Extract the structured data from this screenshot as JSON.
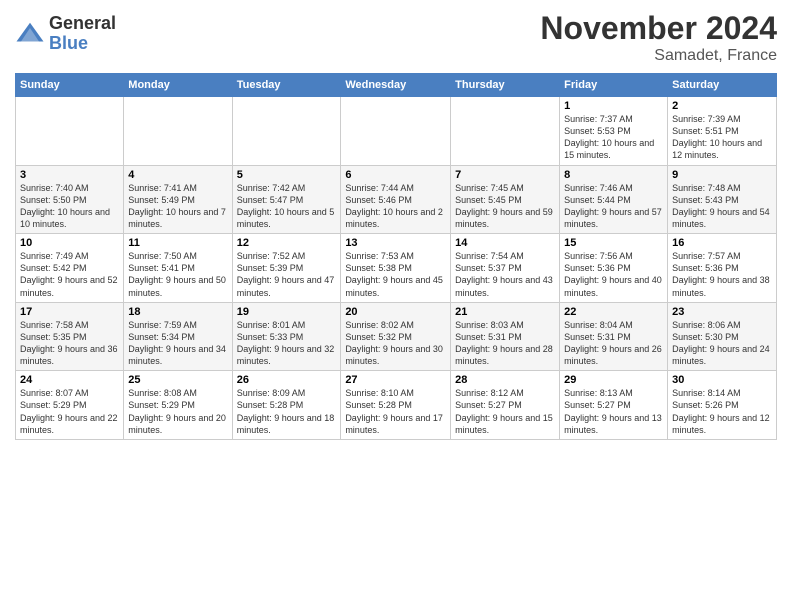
{
  "header": {
    "logo_line1": "General",
    "logo_line2": "Blue",
    "month_title": "November 2024",
    "location": "Samadet, France"
  },
  "days_of_week": [
    "Sunday",
    "Monday",
    "Tuesday",
    "Wednesday",
    "Thursday",
    "Friday",
    "Saturday"
  ],
  "weeks": [
    {
      "days": [
        {
          "num": "",
          "info": ""
        },
        {
          "num": "",
          "info": ""
        },
        {
          "num": "",
          "info": ""
        },
        {
          "num": "",
          "info": ""
        },
        {
          "num": "",
          "info": ""
        },
        {
          "num": "1",
          "info": "Sunrise: 7:37 AM\nSunset: 5:53 PM\nDaylight: 10 hours and 15 minutes."
        },
        {
          "num": "2",
          "info": "Sunrise: 7:39 AM\nSunset: 5:51 PM\nDaylight: 10 hours and 12 minutes."
        }
      ]
    },
    {
      "days": [
        {
          "num": "3",
          "info": "Sunrise: 7:40 AM\nSunset: 5:50 PM\nDaylight: 10 hours and 10 minutes."
        },
        {
          "num": "4",
          "info": "Sunrise: 7:41 AM\nSunset: 5:49 PM\nDaylight: 10 hours and 7 minutes."
        },
        {
          "num": "5",
          "info": "Sunrise: 7:42 AM\nSunset: 5:47 PM\nDaylight: 10 hours and 5 minutes."
        },
        {
          "num": "6",
          "info": "Sunrise: 7:44 AM\nSunset: 5:46 PM\nDaylight: 10 hours and 2 minutes."
        },
        {
          "num": "7",
          "info": "Sunrise: 7:45 AM\nSunset: 5:45 PM\nDaylight: 9 hours and 59 minutes."
        },
        {
          "num": "8",
          "info": "Sunrise: 7:46 AM\nSunset: 5:44 PM\nDaylight: 9 hours and 57 minutes."
        },
        {
          "num": "9",
          "info": "Sunrise: 7:48 AM\nSunset: 5:43 PM\nDaylight: 9 hours and 54 minutes."
        }
      ]
    },
    {
      "days": [
        {
          "num": "10",
          "info": "Sunrise: 7:49 AM\nSunset: 5:42 PM\nDaylight: 9 hours and 52 minutes."
        },
        {
          "num": "11",
          "info": "Sunrise: 7:50 AM\nSunset: 5:41 PM\nDaylight: 9 hours and 50 minutes."
        },
        {
          "num": "12",
          "info": "Sunrise: 7:52 AM\nSunset: 5:39 PM\nDaylight: 9 hours and 47 minutes."
        },
        {
          "num": "13",
          "info": "Sunrise: 7:53 AM\nSunset: 5:38 PM\nDaylight: 9 hours and 45 minutes."
        },
        {
          "num": "14",
          "info": "Sunrise: 7:54 AM\nSunset: 5:37 PM\nDaylight: 9 hours and 43 minutes."
        },
        {
          "num": "15",
          "info": "Sunrise: 7:56 AM\nSunset: 5:36 PM\nDaylight: 9 hours and 40 minutes."
        },
        {
          "num": "16",
          "info": "Sunrise: 7:57 AM\nSunset: 5:36 PM\nDaylight: 9 hours and 38 minutes."
        }
      ]
    },
    {
      "days": [
        {
          "num": "17",
          "info": "Sunrise: 7:58 AM\nSunset: 5:35 PM\nDaylight: 9 hours and 36 minutes."
        },
        {
          "num": "18",
          "info": "Sunrise: 7:59 AM\nSunset: 5:34 PM\nDaylight: 9 hours and 34 minutes."
        },
        {
          "num": "19",
          "info": "Sunrise: 8:01 AM\nSunset: 5:33 PM\nDaylight: 9 hours and 32 minutes."
        },
        {
          "num": "20",
          "info": "Sunrise: 8:02 AM\nSunset: 5:32 PM\nDaylight: 9 hours and 30 minutes."
        },
        {
          "num": "21",
          "info": "Sunrise: 8:03 AM\nSunset: 5:31 PM\nDaylight: 9 hours and 28 minutes."
        },
        {
          "num": "22",
          "info": "Sunrise: 8:04 AM\nSunset: 5:31 PM\nDaylight: 9 hours and 26 minutes."
        },
        {
          "num": "23",
          "info": "Sunrise: 8:06 AM\nSunset: 5:30 PM\nDaylight: 9 hours and 24 minutes."
        }
      ]
    },
    {
      "days": [
        {
          "num": "24",
          "info": "Sunrise: 8:07 AM\nSunset: 5:29 PM\nDaylight: 9 hours and 22 minutes."
        },
        {
          "num": "25",
          "info": "Sunrise: 8:08 AM\nSunset: 5:29 PM\nDaylight: 9 hours and 20 minutes."
        },
        {
          "num": "26",
          "info": "Sunrise: 8:09 AM\nSunset: 5:28 PM\nDaylight: 9 hours and 18 minutes."
        },
        {
          "num": "27",
          "info": "Sunrise: 8:10 AM\nSunset: 5:28 PM\nDaylight: 9 hours and 17 minutes."
        },
        {
          "num": "28",
          "info": "Sunrise: 8:12 AM\nSunset: 5:27 PM\nDaylight: 9 hours and 15 minutes."
        },
        {
          "num": "29",
          "info": "Sunrise: 8:13 AM\nSunset: 5:27 PM\nDaylight: 9 hours and 13 minutes."
        },
        {
          "num": "30",
          "info": "Sunrise: 8:14 AM\nSunset: 5:26 PM\nDaylight: 9 hours and 12 minutes."
        }
      ]
    }
  ]
}
